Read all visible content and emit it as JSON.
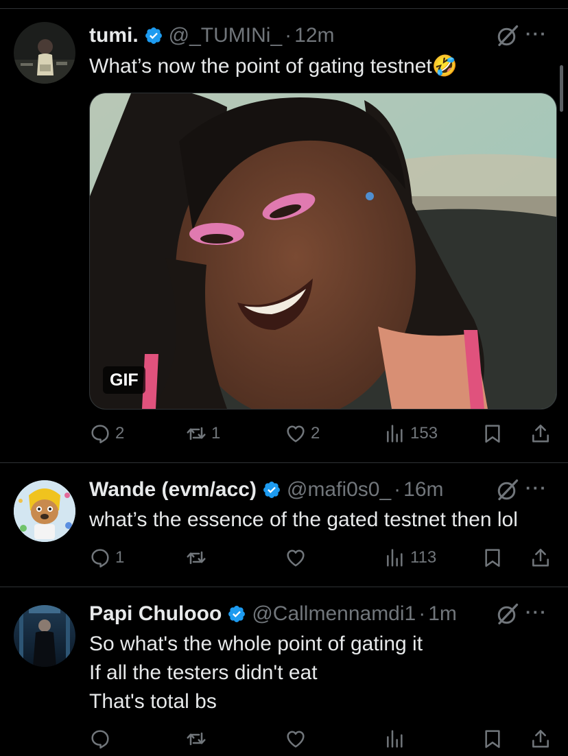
{
  "tweets": [
    {
      "name": "tumi.",
      "handle": "@_TUMINi_",
      "dot": "·",
      "time": "12m",
      "text": [
        "What’s now the point of gating testnet🤣"
      ],
      "media_badge": "GIF",
      "replies": "2",
      "reposts": "1",
      "likes": "2",
      "views": "153"
    },
    {
      "name": "Wande (evm/acc)",
      "handle": "@mafi0s0_",
      "dot": "·",
      "time": "16m",
      "text": [
        "what’s the essence of the gated testnet then lol"
      ],
      "replies": "1",
      "reposts": "",
      "likes": "",
      "views": "113"
    },
    {
      "name": "Papi Chulooo",
      "handle": "@Callmennamdi1",
      "dot": "·",
      "time": "1m",
      "text": [
        "So what's the whole point of gating it",
        "If all the testers didn't eat",
        "That's total bs"
      ],
      "replies": "",
      "reposts": "",
      "likes": "",
      "views": ""
    }
  ],
  "colors": {
    "background": "#000000",
    "text": "#e7e9ea",
    "muted": "#71767b",
    "verified": "#1d9bf0",
    "divider": "#2f3336"
  },
  "icons": [
    "verified-badge-icon",
    "grok-icon",
    "more-icon",
    "reply-icon",
    "repost-icon",
    "like-icon",
    "views-icon",
    "bookmark-icon",
    "share-icon"
  ]
}
